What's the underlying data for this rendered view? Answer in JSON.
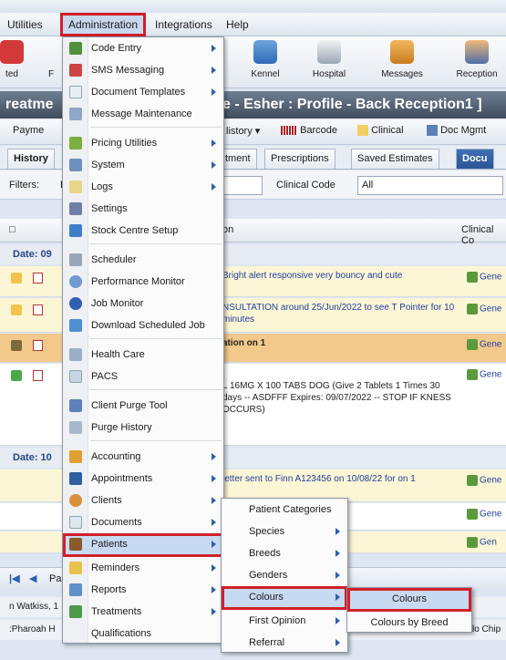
{
  "menubar": {
    "items": [
      "Utilities",
      "Administration",
      "Integrations",
      "Help"
    ]
  },
  "ribbon": {
    "left_partial": "ted",
    "left_partial2": "F",
    "buttons": [
      "Kennel",
      "Hospital",
      "Messages",
      "Reception"
    ]
  },
  "titlebar": {
    "left": "reatme",
    "right": "e - Esher : Profile - Back Reception1 ]"
  },
  "toolbar2": {
    "payme": "Payme",
    "history": "listory",
    "barcode": "Barcode",
    "clinical": "Clinical",
    "docmgmt": "Doc Mgmt"
  },
  "tabs": {
    "history": "History",
    "treatment": "tment",
    "prescriptions": "Prescriptions",
    "saved_estimates": "Saved Estimates",
    "docu": "Docu"
  },
  "filters": {
    "label": "Filters:",
    "partial": "D",
    "clinical_code_label": "Clinical Code",
    "clinical_code_value": "All"
  },
  "grid": {
    "header_desc": "on",
    "header_clinical": "Clinical Co",
    "date1": "Date: 09",
    "date2": "Date: 10",
    "rows": [
      {
        "text": "Bright alert responsive very bouncy and cute",
        "code": "Gene"
      },
      {
        "text": "NSULTATION around 25/Jun/2022 to see T Pointer for 10 minutes",
        "code": "Gene"
      },
      {
        "text": "ation on 1",
        "code": "Gene"
      },
      {
        "text": "L 16MG X 100 TABS DOG (Give 2 Tablets 1 Times 30 days -- ASDFFF Expires: 09/07/2022 -- STOP IF KNESS OCCURS)",
        "code": "Gene"
      },
      {
        "text": "letter sent to Finn A123456 on 10/08/22 for on 1",
        "code": "Gene"
      },
      {
        "text": "on 10/08/22 for",
        "code": "Gene"
      },
      {
        "text": "on 10/08/22 for",
        "code": "Gen"
      }
    ]
  },
  "bottombar": {
    "label": "Pa"
  },
  "status": {
    "line1": "n Watkiss, 1",
    "line2": ":Pharoah H",
    "right": "lo Chip"
  },
  "menu_admin": {
    "items": [
      "Code Entry",
      "SMS Messaging",
      "Document Templates",
      "Message Maintenance",
      "Pricing Utilities",
      "System",
      "Logs",
      "Settings",
      "Stock Centre Setup",
      "Scheduler",
      "Performance Monitor",
      "Job Monitor",
      "Download Scheduled Job",
      "Health Care",
      "PACS",
      "Client Purge Tool",
      "Purge History",
      "Accounting",
      "Appointments",
      "Clients",
      "Documents",
      "Patients",
      "Reminders",
      "Reports",
      "Treatments",
      "Qualifications"
    ]
  },
  "menu_patients": {
    "items": [
      "Patient Categories",
      "Species",
      "Breeds",
      "Genders",
      "Colours",
      "First Opinion",
      "Referral"
    ]
  },
  "menu_colours": {
    "items": [
      "Colours",
      "Colours by Breed"
    ]
  }
}
